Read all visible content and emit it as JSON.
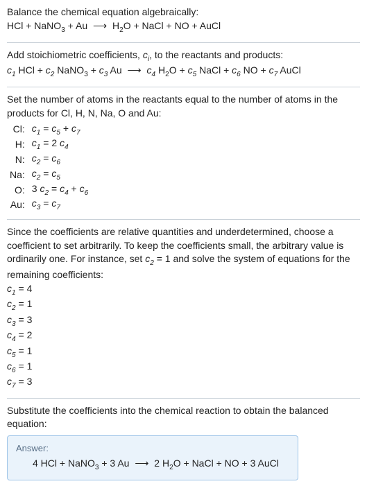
{
  "intro": {
    "title": "Balance the chemical equation algebraically:",
    "reaction": {
      "lhs": [
        "HCl",
        "NaNO_3",
        "Au"
      ],
      "rhs": [
        "H_2O",
        "NaCl",
        "NO",
        "AuCl"
      ]
    }
  },
  "stoich": {
    "text": "Add stoichiometric coefficients, ",
    "text2": ", to the reactants and products:",
    "coef_reaction": {
      "lhs": [
        {
          "c": "c_1",
          "sp": "HCl"
        },
        {
          "c": "c_2",
          "sp": "NaNO_3"
        },
        {
          "c": "c_3",
          "sp": "Au"
        }
      ],
      "rhs": [
        {
          "c": "c_4",
          "sp": "H_2O"
        },
        {
          "c": "c_5",
          "sp": "NaCl"
        },
        {
          "c": "c_6",
          "sp": "NO"
        },
        {
          "c": "c_7",
          "sp": "AuCl"
        }
      ]
    }
  },
  "atoms": {
    "text": "Set the number of atoms in the reactants equal to the number of atoms in the products for Cl, H, N, Na, O and Au:",
    "rows": [
      {
        "el": "Cl:",
        "eq": "c_1 = c_5 + c_7"
      },
      {
        "el": "H:",
        "eq": "c_1 = 2 c_4"
      },
      {
        "el": "N:",
        "eq": "c_2 = c_6"
      },
      {
        "el": "Na:",
        "eq": "c_2 = c_5"
      },
      {
        "el": "O:",
        "eq": "3 c_2 = c_4 + c_6"
      },
      {
        "el": "Au:",
        "eq": "c_3 = c_7"
      }
    ]
  },
  "solve": {
    "text1": "Since the coefficients are relative quantities and underdetermined, choose a coefficient to set arbitrarily. To keep the coefficients small, the arbitrary value is ordinarily one. For instance, set ",
    "text2": " = 1 and solve the system of equations for the remaining coefficients:",
    "coefs": [
      {
        "c": "c_1",
        "v": "4"
      },
      {
        "c": "c_2",
        "v": "1"
      },
      {
        "c": "c_3",
        "v": "3"
      },
      {
        "c": "c_4",
        "v": "2"
      },
      {
        "c": "c_5",
        "v": "1"
      },
      {
        "c": "c_6",
        "v": "1"
      },
      {
        "c": "c_7",
        "v": "3"
      }
    ]
  },
  "subst": {
    "text": "Substitute the coefficients into the chemical reaction to obtain the balanced equation:"
  },
  "answer": {
    "label": "Answer:",
    "lhs": [
      "4 HCl",
      "NaNO_3",
      "3 Au"
    ],
    "rhs": [
      "2 H_2O",
      "NaCl",
      "NO",
      "3 AuCl"
    ]
  },
  "glyphs": {
    "arrow": "⟶",
    "plus": " + "
  }
}
